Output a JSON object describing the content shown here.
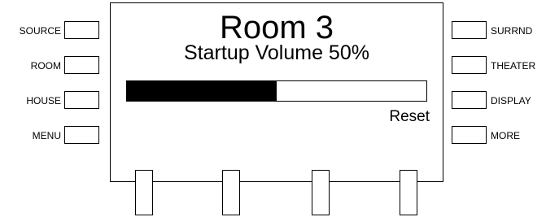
{
  "left_keys": [
    {
      "label": "SOURCE"
    },
    {
      "label": "ROOM"
    },
    {
      "label": "HOUSE"
    },
    {
      "label": "MENU"
    }
  ],
  "right_keys": [
    {
      "label": "SURRND"
    },
    {
      "label": "THEATER"
    },
    {
      "label": "DISPLAY"
    },
    {
      "label": "MORE"
    }
  ],
  "screen": {
    "title": "Room 3",
    "setting_label": "Startup Volume 50%",
    "volume_percent": 50,
    "reset_label": "Reset"
  },
  "bottom_keys": [
    {
      "label": ""
    },
    {
      "label": ""
    },
    {
      "label": ""
    },
    {
      "label": ""
    }
  ]
}
